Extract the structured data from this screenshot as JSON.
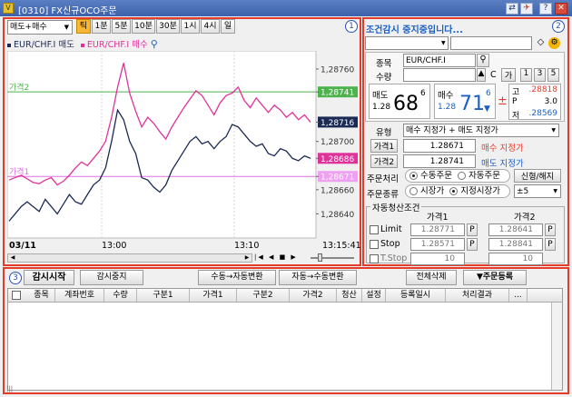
{
  "window": {
    "title": "[0310] FX신규OCO주문",
    "app_icon": "V",
    "buttons": [
      "link-icon",
      "pin-icon",
      "help-icon",
      "close-icon"
    ]
  },
  "chart_panel": {
    "panel_number": "1",
    "side_select": "매도+매수",
    "intervals": [
      "틱",
      "1분",
      "5분",
      "10분",
      "30분",
      "1시",
      "4시",
      "일"
    ],
    "active_interval": "틱",
    "legend": [
      {
        "name": "EUR/CHF.I 매도",
        "color": "#1b2a55"
      },
      {
        "name": "EUR/CHF.I 매수",
        "color": "#e0329b"
      }
    ],
    "price_labels": [
      "1,28760",
      "1,28741",
      "1,28716",
      "1,28700",
      "1,28686",
      "1,28671",
      "1,28660",
      "1,28640"
    ],
    "x_labels": [
      "03/11",
      "13:00",
      "13:10",
      "13:15:41"
    ],
    "line_labels": {
      "price2": "가격2",
      "price1": "가격1"
    }
  },
  "chart_data": {
    "type": "line",
    "ylim": [
      1.2862,
      1.28775
    ],
    "x": [
      0,
      1,
      2,
      3,
      4,
      5,
      6,
      7,
      8,
      9,
      10,
      11,
      12,
      13,
      14,
      15,
      16,
      17,
      18,
      19,
      20,
      21,
      22,
      23,
      24,
      25,
      26,
      27,
      28,
      29,
      30,
      31,
      32,
      33,
      34,
      35,
      36,
      37,
      38,
      39,
      40,
      41,
      42,
      43,
      44,
      45,
      46,
      47,
      48,
      49,
      50
    ],
    "series": [
      {
        "name": "EUR/CHF.I 매수",
        "color": "#e0329b",
        "values": [
          1.28668,
          1.2867,
          1.28672,
          1.28669,
          1.28666,
          1.28665,
          1.28668,
          1.2867,
          1.28664,
          1.28667,
          1.28672,
          1.28678,
          1.28683,
          1.2868,
          1.28686,
          1.28692,
          1.287,
          1.2872,
          1.28745,
          1.28765,
          1.2874,
          1.28725,
          1.28712,
          1.2872,
          1.28715,
          1.28708,
          1.28702,
          1.28712,
          1.2872,
          1.28728,
          1.28735,
          1.28742,
          1.28738,
          1.2873,
          1.28722,
          1.28732,
          1.28738,
          1.2874,
          1.28745,
          1.28734,
          1.28728,
          1.28736,
          1.2873,
          1.28724,
          1.2873,
          1.28726,
          1.2872,
          1.28724,
          1.28718,
          1.28722,
          1.28716
        ]
      },
      {
        "name": "EUR/CHF.I 매도",
        "color": "#1b2a55",
        "values": [
          1.28634,
          1.2864,
          1.28646,
          1.2865,
          1.28646,
          1.28642,
          1.28652,
          1.28646,
          1.2864,
          1.28648,
          1.28656,
          1.2865,
          1.28648,
          1.28656,
          1.28664,
          1.28668,
          1.28678,
          1.287,
          1.28726,
          1.28718,
          1.287,
          1.2869,
          1.2867,
          1.28668,
          1.28662,
          1.28658,
          1.28664,
          1.28676,
          1.28684,
          1.28692,
          1.287,
          1.28704,
          1.28698,
          1.287,
          1.28694,
          1.287,
          1.28704,
          1.28714,
          1.28712,
          1.28706,
          1.287,
          1.28696,
          1.28698,
          1.2869,
          1.28688,
          1.28694,
          1.28692,
          1.28686,
          1.28684,
          1.28688,
          1.28686
        ]
      }
    ],
    "hlines": [
      {
        "label": "가격2",
        "value": 1.28741,
        "color": "#4db34d"
      },
      {
        "label": "가격1",
        "value": 1.28671,
        "color": "#e070e0"
      }
    ],
    "y_tick_labels": [
      "1,28760",
      "1,28700",
      "1,28660",
      "1,28640"
    ]
  },
  "order_panel": {
    "panel_number": "2",
    "status_text": "조건감시 중지중입니다...",
    "account_value": "",
    "account_name": "",
    "symbol_label": "종목",
    "symbol_value": "EUR/CHF.I",
    "qty_label": "수량",
    "qty_value": "",
    "qty_c": "C",
    "qty_ga": "가",
    "qty_buttons": [
      "1",
      "3",
      "5"
    ],
    "sell_label": "매도",
    "sell_price_small": "1.28",
    "sell_price_big": "68",
    "sell_price_sup": "6",
    "buy_label": "매수",
    "buy_price_small": "1.28",
    "buy_price_big": "71",
    "buy_price_sup": "6",
    "stat_labels": {
      "high": "고",
      "p": "P",
      "low": "저"
    },
    "stats": {
      "high": ".28818",
      "p": "3.0",
      "low": ".28569"
    },
    "type_label": "유형",
    "type_value": "매수 지정가 + 매도 지정가",
    "price1_label": "가격1",
    "price1_value": "1.28671",
    "price1_desc": "매수 지정가",
    "price2_label": "가격2",
    "price2_value": "1.28741",
    "price2_desc": "매도 지정가",
    "order_process_label": "주문처리",
    "order_process_options": [
      "수동주문",
      "자동주문"
    ],
    "new_close_button": "신형/해지",
    "order_type_label": "주문종류",
    "order_type_options": [
      "시장가",
      "지정시장가"
    ],
    "order_type_step": "±5",
    "auto_settle_title": "자동청산조건",
    "col_price1": "가격1",
    "col_price2": "가격2",
    "rows": [
      {
        "label": "Limit",
        "p1": "1.28771",
        "p2": "1.28641",
        "btn": "P"
      },
      {
        "label": "Stop",
        "p1": "1.28571",
        "p2": "1.28841",
        "btn": "P"
      },
      {
        "label": "T.Stop",
        "p1": "10",
        "p2": "10",
        "btn": ""
      }
    ]
  },
  "bottom_panel": {
    "panel_number": "3",
    "start_button": "감시시작",
    "stop_button": "감시중지",
    "manual_to_auto": "수동→자동변환",
    "auto_to_manual": "자동→수동변환",
    "delete_all": "전체삭제",
    "register_order": "▼주문등록",
    "columns": [
      "종목",
      "계좌번호",
      "수량",
      "구분1",
      "가격1",
      "구분2",
      "가격2",
      "청산",
      "설정",
      "등록일시",
      "처리결과",
      "..."
    ]
  },
  "colors": {
    "sell": "#000",
    "buy": "#1b5fc4",
    "red": "#e53b2a",
    "pink_line": "#e0329b",
    "navy_line": "#1b2a55"
  }
}
